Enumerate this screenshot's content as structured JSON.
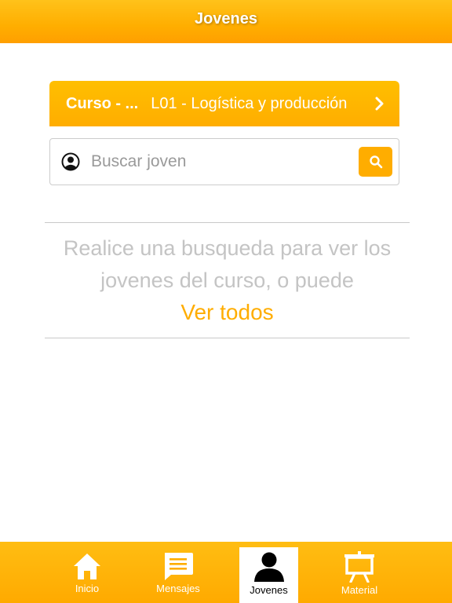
{
  "header": {
    "title": "Jovenes"
  },
  "course": {
    "label": "Curso - ...",
    "value": "L01 - Logística y producción"
  },
  "search": {
    "placeholder": "Buscar joven",
    "value": ""
  },
  "empty_state": {
    "message": "Realice una busqueda para ver los jovenes del curso, o puede",
    "link": "Ver todos"
  },
  "tabs": [
    {
      "label": "Inicio",
      "icon": "home-icon",
      "active": false
    },
    {
      "label": "Mensajes",
      "icon": "message-icon",
      "active": false
    },
    {
      "label": "Jovenes",
      "icon": "person-icon",
      "active": true
    },
    {
      "label": "Material",
      "icon": "presentation-board-icon",
      "active": false
    }
  ],
  "colors": {
    "accent": "#ffad00",
    "header_light": "#ffc21a",
    "muted_text": "#c4c4c4",
    "divider": "#c9c9c9"
  }
}
